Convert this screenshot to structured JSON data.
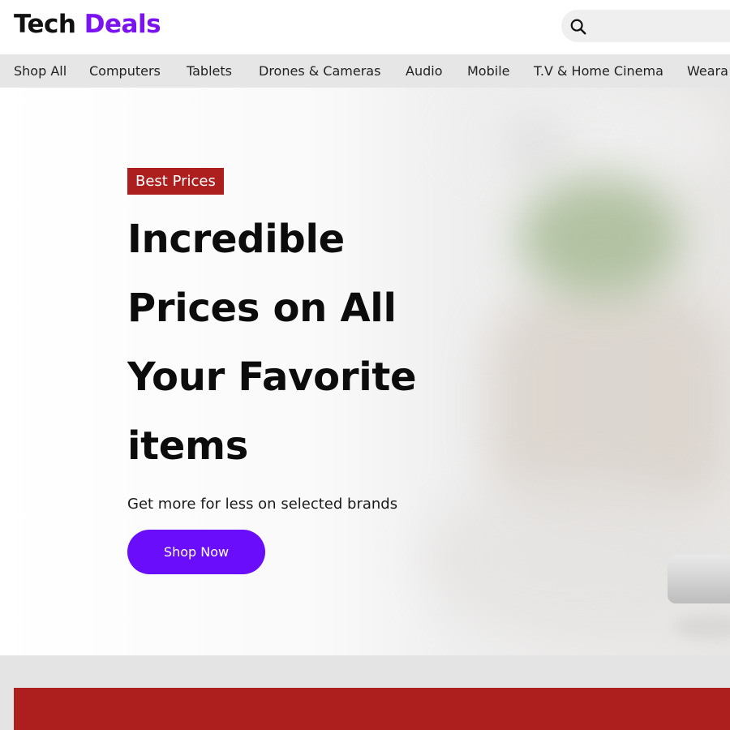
{
  "header": {
    "logo_part1": "Tech",
    "logo_part2": "Deals",
    "search_icon": "search-icon"
  },
  "nav": {
    "items": [
      {
        "label": "Shop All"
      },
      {
        "label": "Computers"
      },
      {
        "label": "Tablets"
      },
      {
        "label": "Drones & Cameras"
      },
      {
        "label": "Audio"
      },
      {
        "label": "Mobile"
      },
      {
        "label": "T.V & Home Cinema"
      },
      {
        "label": "Weara"
      }
    ]
  },
  "hero": {
    "badge": "Best Prices",
    "headline_lines": [
      "Incredible",
      "Prices on All",
      "Your Favorite",
      "items"
    ],
    "subtext": "Get more for less on selected brands",
    "cta_label": "Shop Now"
  },
  "colors": {
    "brand_purple": "#7b12f0",
    "cta_purple": "#6a0dfa",
    "badge_red": "#ad1f1f",
    "nav_gray": "#e6e6e6"
  }
}
